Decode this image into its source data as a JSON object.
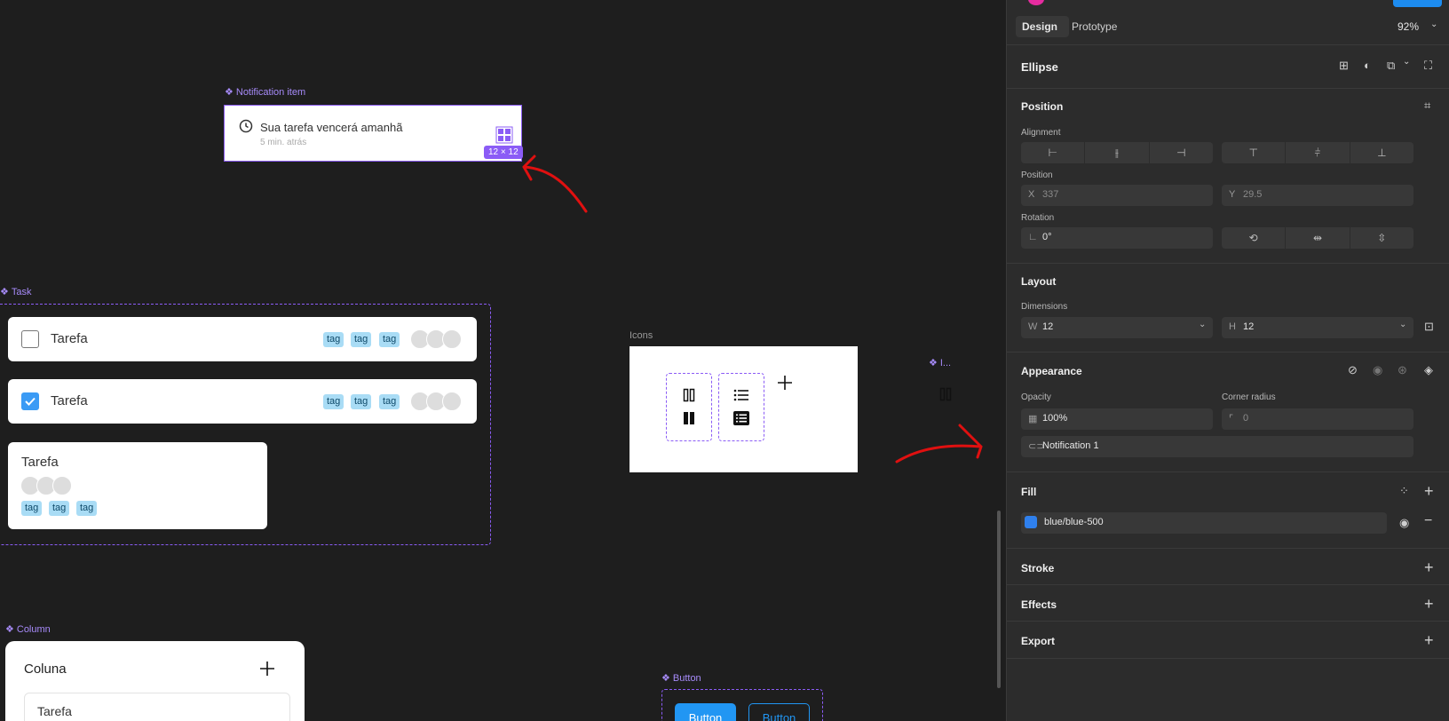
{
  "canvas": {
    "notification_frame_label": "Notification item",
    "notification": {
      "title": "Sua tarefa vencerá amanhã",
      "subtitle": "5 min. atrás"
    },
    "size_badge": "12 × 12",
    "task_frame_label": "Task",
    "tasks": [
      {
        "title": "Tarefa",
        "tags": [
          "tag",
          "tag",
          "tag"
        ]
      },
      {
        "title": "Tarefa",
        "tags": [
          "tag",
          "tag",
          "tag"
        ]
      },
      {
        "title": "Tarefa",
        "tags": [
          "tag",
          "tag",
          "tag"
        ]
      }
    ],
    "icons_frame_label": "Icons",
    "icon_component_label": "I...",
    "column_frame_label": "Column",
    "column": {
      "title": "Coluna",
      "task_title": "Tarefa"
    },
    "button_frame_label": "Button",
    "buttons": [
      "Button",
      "Button"
    ]
  },
  "panel": {
    "tabs": [
      "Design",
      "Prototype"
    ],
    "zoom": "92%",
    "layer_name": "Ellipse",
    "position_section": "Position",
    "alignment_label": "Alignment",
    "position_label": "Position",
    "x_label": "X",
    "x_value": "337",
    "y_label": "Y",
    "y_value": "29.5",
    "rotation_label": "Rotation",
    "rotation_value": "0°",
    "layout_section": "Layout",
    "dimensions_label": "Dimensions",
    "w_label": "W",
    "w_value": "12",
    "h_label": "H",
    "h_value": "12",
    "appearance_section": "Appearance",
    "opacity_label": "Opacity",
    "opacity_value": "100%",
    "corner_label": "Corner radius",
    "corner_value": "0",
    "variable_name": "Notification 1",
    "fill_section": "Fill",
    "fill_color_name": "blue/blue-500",
    "fill_color": "#2f80ed",
    "stroke_section": "Stroke",
    "effects_section": "Effects",
    "export_section": "Export"
  },
  "colors": {
    "accent": "#8b5cf6",
    "checkbox_blue": "#3b9bf5",
    "button_blue": "#2196f3",
    "annotation_red": "#e01010"
  }
}
